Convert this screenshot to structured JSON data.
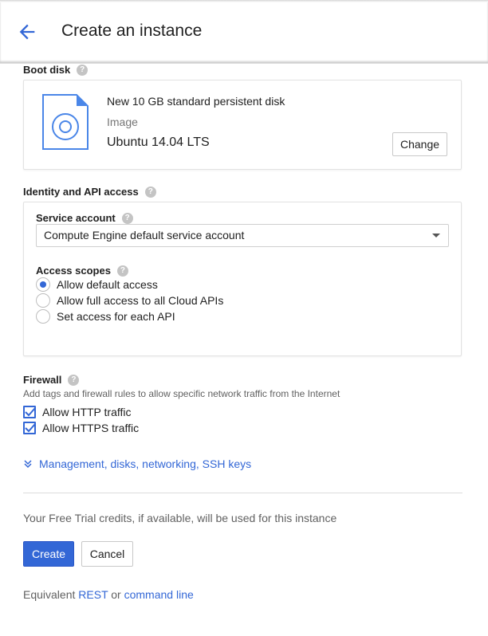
{
  "header": {
    "title": "Create an instance",
    "back_icon": "arrow-back-icon"
  },
  "boot_disk": {
    "label": "Boot disk",
    "disk_name": "New 10 GB standard persistent disk",
    "image_label": "Image",
    "image_value": "Ubuntu 14.04 LTS",
    "change_label": "Change"
  },
  "identity": {
    "label": "Identity and API access",
    "service_account_label": "Service account",
    "service_account_value": "Compute Engine default service account",
    "access_scopes_label": "Access scopes",
    "scopes": [
      {
        "label": "Allow default access",
        "selected": true
      },
      {
        "label": "Allow full access to all Cloud APIs",
        "selected": false
      },
      {
        "label": "Set access for each API",
        "selected": false
      }
    ]
  },
  "firewall": {
    "label": "Firewall",
    "description": "Add tags and firewall rules to allow specific network traffic from the Internet",
    "options": [
      {
        "label": "Allow HTTP traffic",
        "checked": true
      },
      {
        "label": "Allow HTTPS traffic",
        "checked": true
      }
    ]
  },
  "management_link": "Management, disks, networking, SSH keys",
  "trial_text": "Your Free Trial credits, if available, will be used for this instance",
  "actions": {
    "create_label": "Create",
    "cancel_label": "Cancel"
  },
  "equivalent": {
    "prefix": "Equivalent",
    "rest_label": "REST",
    "or_label": "or",
    "command_line_label": "command line"
  },
  "colors": {
    "accent": "#3367d6",
    "help_icon": "#c4c4c4"
  }
}
